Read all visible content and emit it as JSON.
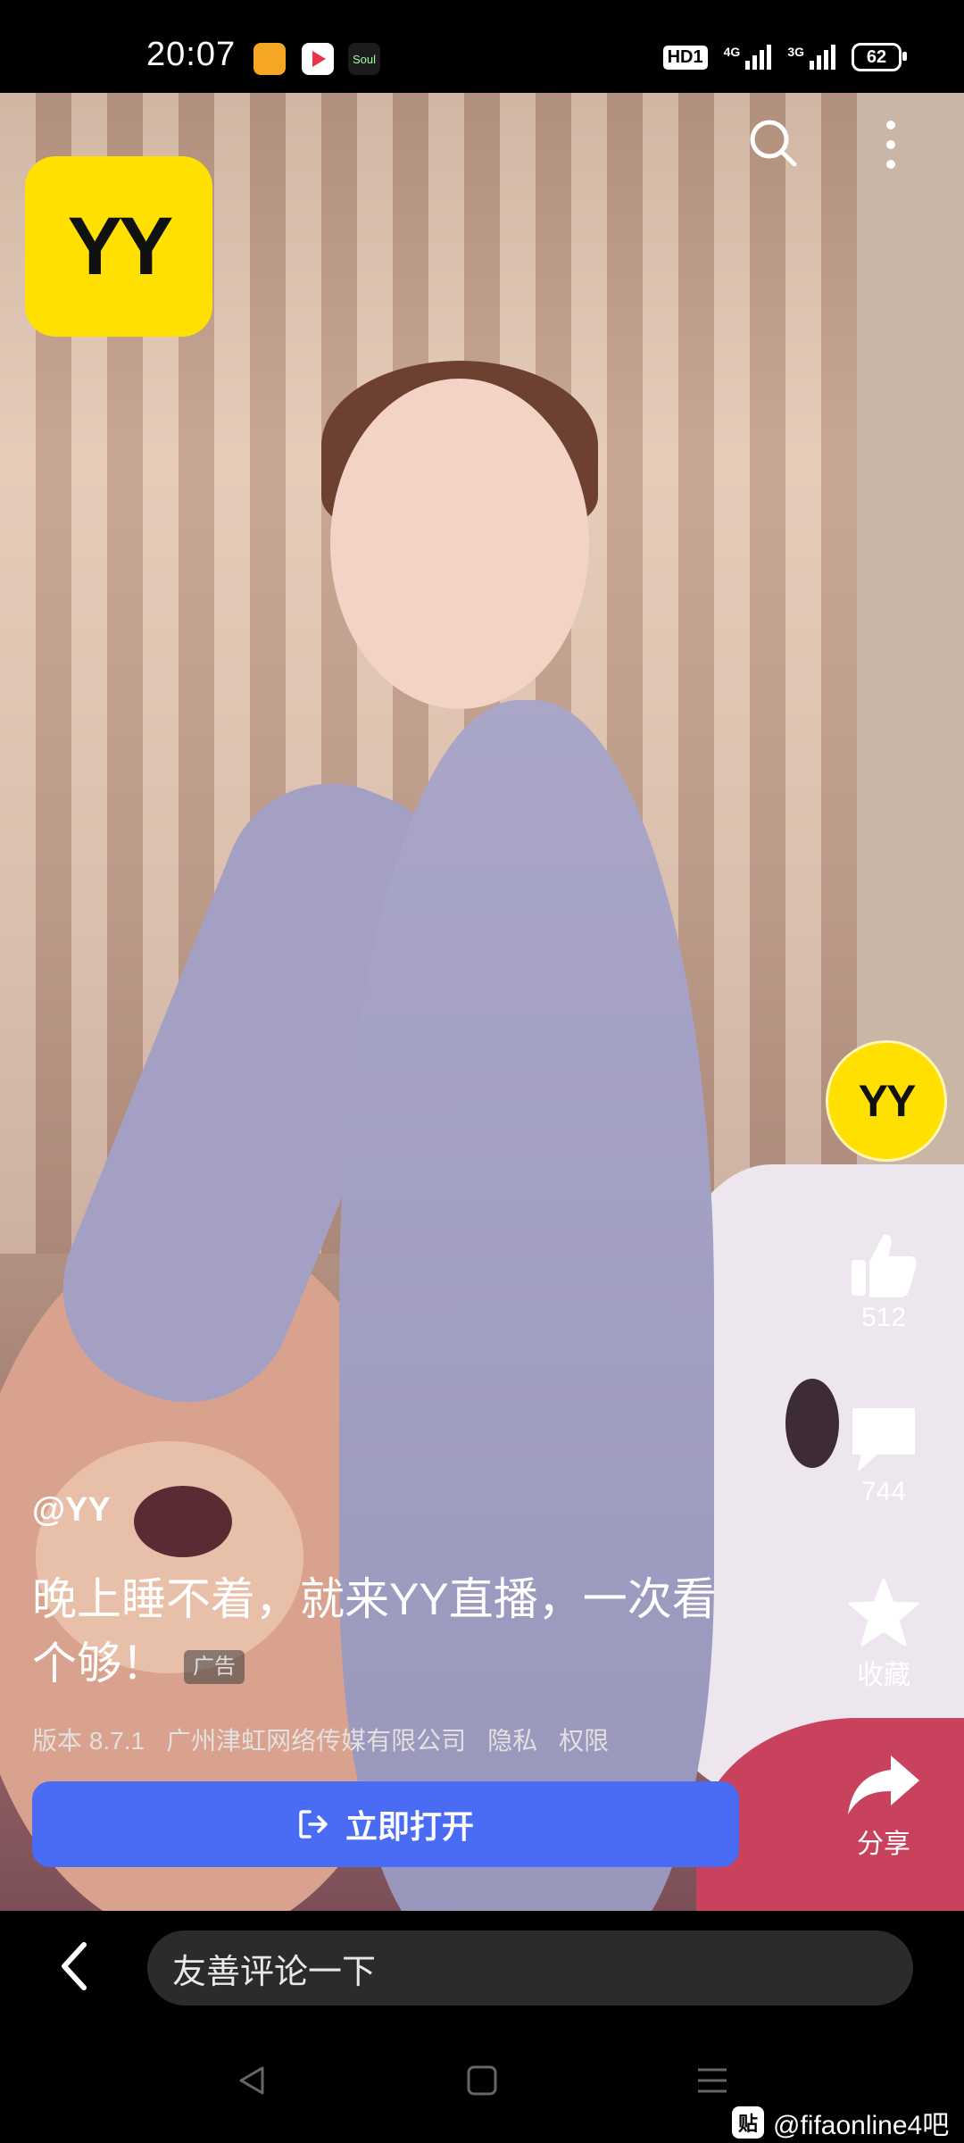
{
  "status_bar": {
    "time": "20:07",
    "apps": [
      {
        "name": "car-app-icon",
        "color": "#f5a623"
      },
      {
        "name": "video-app-icon",
        "color": "#e8334a"
      },
      {
        "name": "soul-app-icon",
        "color": "#1c1c1c",
        "label": "Soul"
      }
    ],
    "hd": "HD1",
    "net1": "4G",
    "net2": "3G",
    "battery": "62"
  },
  "ad": {
    "logo_text": "YY",
    "avatar_text": "YY",
    "likes": "512",
    "comments": "744",
    "favorite_label": "收藏",
    "share_label": "分享",
    "handle": "@YY",
    "title": "晚上睡不着，就来YY直播，一次看个够！",
    "ad_badge": "广告",
    "meta": {
      "version": "版本 8.7.1",
      "company": "广州津虹网络传媒有限公司",
      "privacy": "隐私",
      "permissions": "权限"
    },
    "open_button": "立即打开"
  },
  "comment_input": {
    "placeholder": "友善评论一下"
  },
  "watermark": {
    "logo": "贴",
    "text": "@fifaonline4吧"
  },
  "colors": {
    "yy_yellow": "#ffe000",
    "button_blue": "#4a6cf5"
  }
}
